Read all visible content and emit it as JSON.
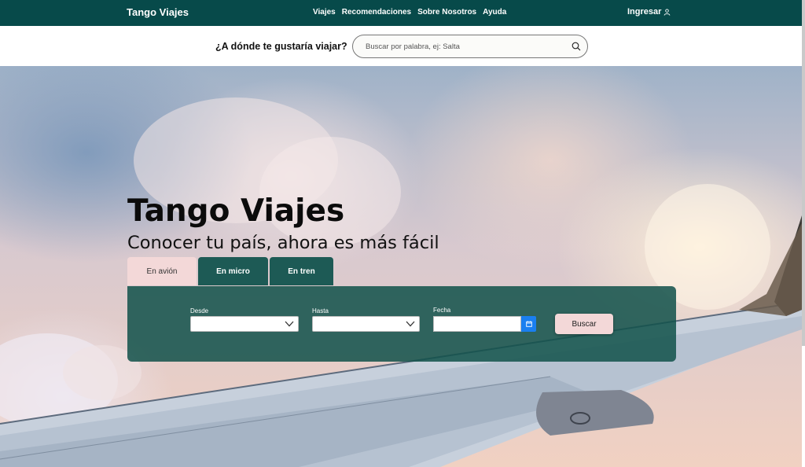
{
  "navbar": {
    "brand": "Tango Viajes",
    "links": [
      "Viajes",
      "Recomendaciones",
      "Sobre Nosotros",
      "Ayuda"
    ],
    "login_label": "Ingresar",
    "login_icon": "user-icon",
    "bg_color": "#074a4a"
  },
  "search": {
    "question": "¿A dónde te gustaría viajar?",
    "placeholder": "Buscar por palabra, ej: Salta",
    "value": "",
    "icon": "search-icon"
  },
  "hero": {
    "title": "Tango Viajes",
    "subtitle": "Conocer tu país, ahora es más fácil"
  },
  "tabs": [
    {
      "label": "En avión",
      "active": true
    },
    {
      "label": "En micro",
      "active": false
    },
    {
      "label": "En tren",
      "active": false
    }
  ],
  "form": {
    "desde_label": "Desde",
    "desde_value": "",
    "hasta_label": "Hasta",
    "hasta_value": "",
    "fecha_label": "Fecha",
    "fecha_value": "",
    "buscar_label": "Buscar",
    "calendar_icon": "calendar-icon",
    "panel_color": "#11524a",
    "accent_pink": "#f3d8d8",
    "calendar_button_color": "#1a7ff0"
  }
}
